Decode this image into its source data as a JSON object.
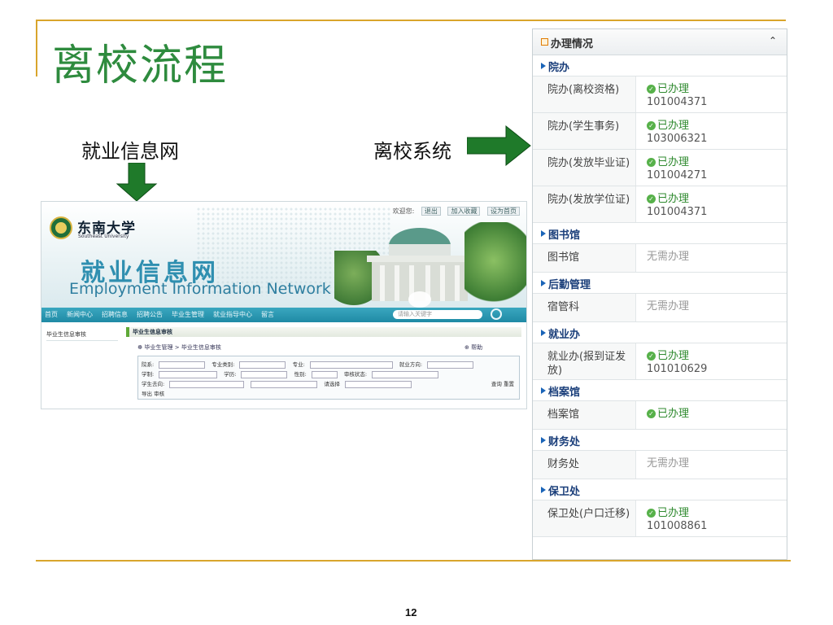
{
  "slide": {
    "title": "离校流程",
    "label_left": "就业信息网",
    "label_right": "离校系统",
    "page_number": "12",
    "accent_color": "#d9a52c",
    "title_color": "#2e8b3e",
    "arrow_color": "#1f7a2a"
  },
  "site": {
    "top_links": [
      "欢迎您:",
      "退出",
      "加入收藏",
      "设为首页"
    ],
    "university_cn": "东南大学",
    "university_en": "Southeast University",
    "site_title_cn": "就业信息网",
    "site_title_en": "Employment Information Network",
    "nav": [
      "首页",
      "新闻中心",
      "招聘信息",
      "招聘公告",
      "毕业生管理",
      "就业指导中心",
      "留言"
    ],
    "search_placeholder": "请输入关键字",
    "sidebar_item": "毕业生信息审核",
    "panel_title": "毕业生信息审核",
    "breadcrumb": "毕业生管理 > 毕业生信息审核",
    "help": "帮助",
    "form": {
      "row1": [
        "院系:",
        "专业类别:",
        "专业:",
        "就业方向:"
      ],
      "row2": [
        "学制:",
        "学历:",
        "性别:",
        "审核状态:"
      ],
      "row3": [
        "学生去向:",
        "请选择"
      ],
      "select_placeholder": "请选择",
      "search_button": "查询",
      "reset_button": "重置",
      "export_button": "导出",
      "audit_button": "审核"
    }
  },
  "panel": {
    "title": "办理情况",
    "collapse_icon": "double-chevron-up-icon",
    "sections": [
      {
        "title": "院办",
        "rows": [
          {
            "name": "院办(离校资格)",
            "status": "已办理",
            "code": "101004371",
            "done": true
          },
          {
            "name": "院办(学生事务)",
            "status": "已办理",
            "code": "103006321",
            "done": true
          },
          {
            "name": "院办(发放毕业证)",
            "status": "已办理",
            "code": "101004271",
            "done": true
          },
          {
            "name": "院办(发放学位证)",
            "status": "已办理",
            "code": "101004371",
            "done": true
          }
        ]
      },
      {
        "title": "图书馆",
        "rows": [
          {
            "name": "图书馆",
            "status": "无需办理",
            "code": "",
            "done": false
          }
        ]
      },
      {
        "title": "后勤管理",
        "rows": [
          {
            "name": "宿管科",
            "status": "无需办理",
            "code": "",
            "done": false
          }
        ]
      },
      {
        "title": "就业办",
        "rows": [
          {
            "name": "就业办(报到证发放)",
            "status": "已办理",
            "code": "101010629",
            "done": true
          }
        ]
      },
      {
        "title": "档案馆",
        "rows": [
          {
            "name": "档案馆",
            "status": "已办理",
            "code": "",
            "done": true
          }
        ]
      },
      {
        "title": "财务处",
        "rows": [
          {
            "name": "财务处",
            "status": "无需办理",
            "code": "",
            "done": false
          }
        ]
      },
      {
        "title": "保卫处",
        "rows": [
          {
            "name": "保卫处(户口迁移)",
            "status": "已办理",
            "code": "101008861",
            "done": true
          }
        ]
      }
    ]
  }
}
